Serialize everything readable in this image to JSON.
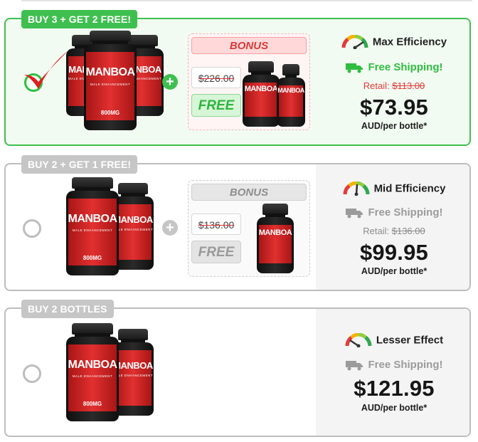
{
  "offers": [
    {
      "badge": "BUY 3 + GET 2 FREE!",
      "bonus_label": "BONUS",
      "old_price": "$226.00",
      "free_label": "FREE",
      "efficiency": "Max Efficiency",
      "shipping": "Free Shipping!",
      "retail_label": "Retail:",
      "retail_price": "$113.00",
      "price": "$73.95",
      "per_bottle": "AUD/per bottle*",
      "selected": true
    },
    {
      "badge": "BUY 2 + GET 1 FREE!",
      "bonus_label": "BONUS",
      "old_price": "$136.00",
      "free_label": "FREE",
      "efficiency": "Mid Efficiency",
      "shipping": "Free Shipping!",
      "retail_label": "Retail:",
      "retail_price": "$136.00",
      "price": "$99.95",
      "per_bottle": "AUD/per bottle*",
      "selected": false
    },
    {
      "badge": "BUY 2 BOTTLES",
      "efficiency": "Lesser Effect",
      "shipping": "Free Shipping!",
      "price": "$121.95",
      "per_bottle": "AUD/per bottle*",
      "selected": false
    }
  ],
  "bottle": {
    "brand": "MANBOA",
    "subtitle": "MALE ENHANCEMENT",
    "dose": "800MG",
    "count": "30 CAPSULES"
  },
  "colors": {
    "accent_green": "#3fbf4f",
    "retail_red": "#e23b3b",
    "bottle_red": "#d42a2a",
    "inactive_gray": "#c6c6c6"
  },
  "icons": [
    "check-mark-icon",
    "plus-icon",
    "gauge-icon",
    "truck-icon"
  ]
}
